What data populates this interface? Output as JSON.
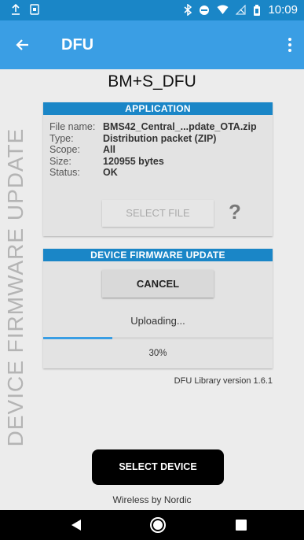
{
  "status_bar": {
    "time": "10:09",
    "left_icons": [
      "upload-icon",
      "sim-card-icon"
    ],
    "right_icons": [
      "bluetooth-icon",
      "do-not-disturb-icon",
      "wifi-icon",
      "no-signal-icon",
      "battery-icon"
    ]
  },
  "app_bar": {
    "title": "DFU",
    "back_icon": "arrow-back-icon",
    "menu_icon": "more-vert-icon"
  },
  "device_name": "BM+S_DFU",
  "side_label": "DEVICE FIRMWARE UPDATE",
  "application": {
    "header": "APPLICATION",
    "rows": [
      {
        "label": "File name:",
        "value": "BMS42_Central_...pdate_OTA.zip"
      },
      {
        "label": "Type:",
        "value": "Distribution packet (ZIP)"
      },
      {
        "label": "Scope:",
        "value": "All"
      },
      {
        "label": "Size:",
        "value": "120955 bytes"
      },
      {
        "label": "Status:",
        "value": "OK"
      }
    ],
    "select_file_label": "SELECT FILE",
    "help_glyph": "?"
  },
  "dfu": {
    "header": "DEVICE FIRMWARE UPDATE",
    "cancel_label": "CANCEL",
    "status": "Uploading...",
    "progress": 0.3,
    "progress_text": "30%"
  },
  "lib_version": "DFU Library version 1.6.1",
  "select_device_label": "SELECT DEVICE",
  "footer": "Wireless by Nordic",
  "colors": {
    "primary": "#3a9ee4",
    "primary_dark": "#1a86c7",
    "panel": "#e3e3e3",
    "background": "#ececec"
  }
}
